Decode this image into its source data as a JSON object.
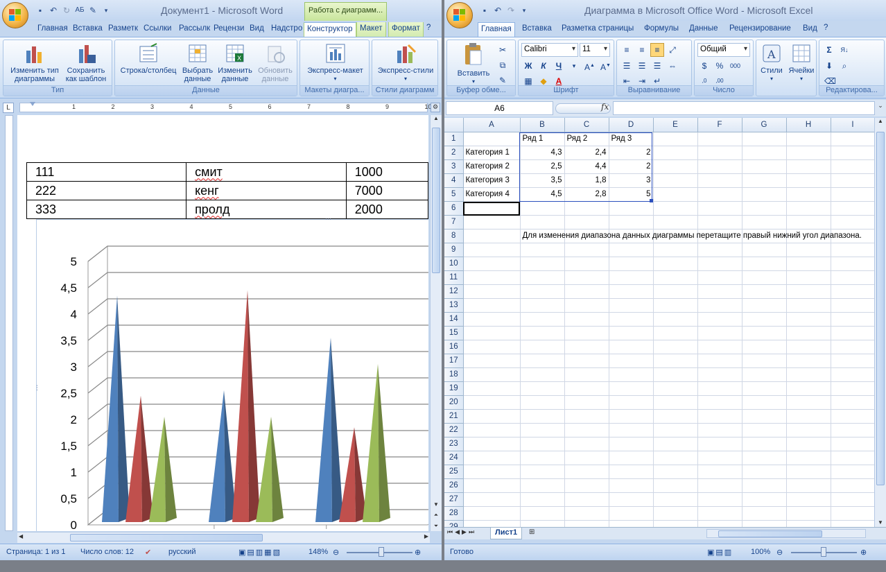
{
  "word": {
    "title": "Документ1 - Microsoft Word",
    "context_tab": "Работа с диаграмм...",
    "tabs": [
      "Главная",
      "Вставка",
      "Разметк",
      "Ссылки",
      "Рассылк",
      "Рецензи",
      "Вид",
      "Надстро",
      "Конструктор",
      "Макет",
      "Формат"
    ],
    "active_tab": "Конструктор",
    "ribbon": {
      "groups": [
        {
          "label": "Тип",
          "buttons": [
            "Изменить тип диаграммы",
            "Сохранить как шаблон"
          ]
        },
        {
          "label": "Данные",
          "buttons": [
            "Строка/столбец",
            "Выбрать данные",
            "Изменить данные",
            "Обновить данные"
          ]
        },
        {
          "label": "Макеты диагра...",
          "buttons": [
            "Экспресс-макет"
          ]
        },
        {
          "label": "Стили диаграмм",
          "buttons": [
            "Экспресс-стили"
          ]
        }
      ],
      "type_label": "Тип",
      "data_label": "Данные",
      "layouts_label": "Макеты диагра...",
      "styles_label": "Стили диаграмм",
      "btn_change_type": "Изменить тип",
      "btn_change_type2": "диаграммы",
      "btn_save_tpl": "Сохранить",
      "btn_save_tpl2": "как шаблон",
      "btn_rowcol": "Строка/столбец",
      "btn_select": "Выбрать",
      "btn_select2": "данные",
      "btn_edit": "Изменить",
      "btn_edit2": "данные",
      "btn_refresh": "Обновить",
      "btn_refresh2": "данные",
      "btn_quick_layout": "Экспресс-макет",
      "btn_quick_style": "Экспресс-стили"
    },
    "ruler_numbers": [
      "1",
      "2",
      "3",
      "4",
      "5",
      "6",
      "7",
      "8",
      "9",
      "10"
    ],
    "table": [
      [
        "111",
        "смит",
        "1000"
      ],
      [
        "222",
        "кенг",
        "7000"
      ],
      [
        "333",
        "пролд",
        "2000"
      ]
    ],
    "status": {
      "page": "Страница: 1 из 1",
      "words": "Число слов: 12",
      "lang": "русский",
      "zoom": "148%"
    }
  },
  "excel": {
    "title": "Диаграмма в Microsoft Office Word - Microsoft Excel",
    "tabs": [
      "Главная",
      "Вставка",
      "Разметка страницы",
      "Формулы",
      "Данные",
      "Рецензирование",
      "Вид"
    ],
    "active_tab": "Главная",
    "ribbon": {
      "clipboard_label": "Буфер обме...",
      "font_label": "Шрифт",
      "align_label": "Выравнивание",
      "number_label": "Число",
      "editing_label": "Редактирова...",
      "paste": "Вставить",
      "font_name": "Calibri",
      "font_size": "11",
      "number_format": "Общий",
      "styles": "Стили",
      "cells": "Ячейки"
    },
    "name_box": "A6",
    "fx": "fx",
    "col_headers": [
      "A",
      "B",
      "C",
      "D",
      "E",
      "F",
      "G",
      "H",
      "I"
    ],
    "rows": [
      [
        "",
        "Ряд 1",
        "Ряд 2",
        "Ряд 3",
        "",
        "",
        "",
        "",
        ""
      ],
      [
        "Категория 1",
        "4,3",
        "2,4",
        "2",
        "",
        "",
        "",
        "",
        ""
      ],
      [
        "Категория 2",
        "2,5",
        "4,4",
        "2",
        "",
        "",
        "",
        "",
        ""
      ],
      [
        "Категория 3",
        "3,5",
        "1,8",
        "3",
        "",
        "",
        "",
        "",
        ""
      ],
      [
        "Категория 4",
        "4,5",
        "2,8",
        "5",
        "",
        "",
        "",
        "",
        ""
      ]
    ],
    "note": "Для изменения диапазона данных диаграммы перетащите правый нижний угол диапазона.",
    "row_count": 29,
    "sheet_tab": "Лист1",
    "status": {
      "ready": "Готово",
      "zoom": "100%"
    }
  },
  "chart_data": {
    "type": "bar",
    "categories": [
      "Категория 1",
      "Категория 2",
      "Категория 3"
    ],
    "series": [
      {
        "name": "Ряд 1",
        "values": [
          4.3,
          2.5,
          3.5
        ],
        "color": "#4f81bd"
      },
      {
        "name": "Ряд 2",
        "values": [
          2.4,
          4.4,
          1.8
        ],
        "color": "#c0504d"
      },
      {
        "name": "Ряд 3",
        "values": [
          2,
          2,
          3
        ],
        "color": "#9bbb59"
      }
    ],
    "ylim": [
      0,
      5
    ],
    "yticks": [
      "0",
      "0,5",
      "1",
      "1,5",
      "2",
      "2,5",
      "3",
      "3,5",
      "4",
      "4,5",
      "5"
    ],
    "title": "",
    "xlabel": "",
    "ylabel": "",
    "grid": true
  }
}
